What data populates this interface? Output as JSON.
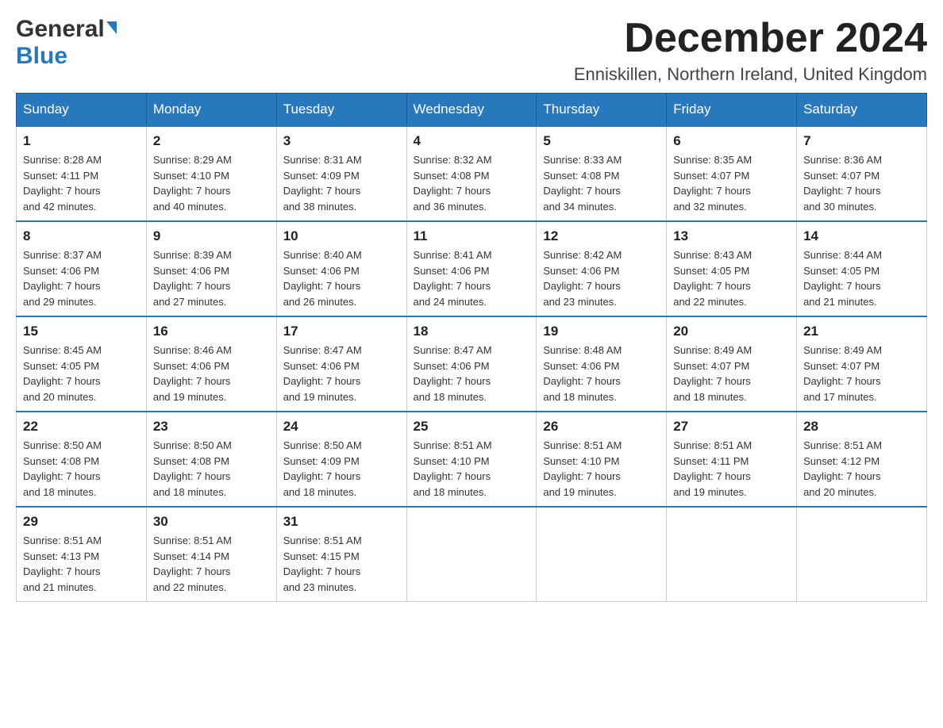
{
  "header": {
    "logo_general": "General",
    "logo_blue": "Blue",
    "month_title": "December 2024",
    "location": "Enniskillen, Northern Ireland, United Kingdom"
  },
  "days_of_week": [
    "Sunday",
    "Monday",
    "Tuesday",
    "Wednesday",
    "Thursday",
    "Friday",
    "Saturday"
  ],
  "weeks": [
    [
      {
        "day": "1",
        "sunrise": "8:28 AM",
        "sunset": "4:11 PM",
        "daylight": "7 hours and 42 minutes."
      },
      {
        "day": "2",
        "sunrise": "8:29 AM",
        "sunset": "4:10 PM",
        "daylight": "7 hours and 40 minutes."
      },
      {
        "day": "3",
        "sunrise": "8:31 AM",
        "sunset": "4:09 PM",
        "daylight": "7 hours and 38 minutes."
      },
      {
        "day": "4",
        "sunrise": "8:32 AM",
        "sunset": "4:08 PM",
        "daylight": "7 hours and 36 minutes."
      },
      {
        "day": "5",
        "sunrise": "8:33 AM",
        "sunset": "4:08 PM",
        "daylight": "7 hours and 34 minutes."
      },
      {
        "day": "6",
        "sunrise": "8:35 AM",
        "sunset": "4:07 PM",
        "daylight": "7 hours and 32 minutes."
      },
      {
        "day": "7",
        "sunrise": "8:36 AM",
        "sunset": "4:07 PM",
        "daylight": "7 hours and 30 minutes."
      }
    ],
    [
      {
        "day": "8",
        "sunrise": "8:37 AM",
        "sunset": "4:06 PM",
        "daylight": "7 hours and 29 minutes."
      },
      {
        "day": "9",
        "sunrise": "8:39 AM",
        "sunset": "4:06 PM",
        "daylight": "7 hours and 27 minutes."
      },
      {
        "day": "10",
        "sunrise": "8:40 AM",
        "sunset": "4:06 PM",
        "daylight": "7 hours and 26 minutes."
      },
      {
        "day": "11",
        "sunrise": "8:41 AM",
        "sunset": "4:06 PM",
        "daylight": "7 hours and 24 minutes."
      },
      {
        "day": "12",
        "sunrise": "8:42 AM",
        "sunset": "4:06 PM",
        "daylight": "7 hours and 23 minutes."
      },
      {
        "day": "13",
        "sunrise": "8:43 AM",
        "sunset": "4:05 PM",
        "daylight": "7 hours and 22 minutes."
      },
      {
        "day": "14",
        "sunrise": "8:44 AM",
        "sunset": "4:05 PM",
        "daylight": "7 hours and 21 minutes."
      }
    ],
    [
      {
        "day": "15",
        "sunrise": "8:45 AM",
        "sunset": "4:05 PM",
        "daylight": "7 hours and 20 minutes."
      },
      {
        "day": "16",
        "sunrise": "8:46 AM",
        "sunset": "4:06 PM",
        "daylight": "7 hours and 19 minutes."
      },
      {
        "day": "17",
        "sunrise": "8:47 AM",
        "sunset": "4:06 PM",
        "daylight": "7 hours and 19 minutes."
      },
      {
        "day": "18",
        "sunrise": "8:47 AM",
        "sunset": "4:06 PM",
        "daylight": "7 hours and 18 minutes."
      },
      {
        "day": "19",
        "sunrise": "8:48 AM",
        "sunset": "4:06 PM",
        "daylight": "7 hours and 18 minutes."
      },
      {
        "day": "20",
        "sunrise": "8:49 AM",
        "sunset": "4:07 PM",
        "daylight": "7 hours and 18 minutes."
      },
      {
        "day": "21",
        "sunrise": "8:49 AM",
        "sunset": "4:07 PM",
        "daylight": "7 hours and 17 minutes."
      }
    ],
    [
      {
        "day": "22",
        "sunrise": "8:50 AM",
        "sunset": "4:08 PM",
        "daylight": "7 hours and 18 minutes."
      },
      {
        "day": "23",
        "sunrise": "8:50 AM",
        "sunset": "4:08 PM",
        "daylight": "7 hours and 18 minutes."
      },
      {
        "day": "24",
        "sunrise": "8:50 AM",
        "sunset": "4:09 PM",
        "daylight": "7 hours and 18 minutes."
      },
      {
        "day": "25",
        "sunrise": "8:51 AM",
        "sunset": "4:10 PM",
        "daylight": "7 hours and 18 minutes."
      },
      {
        "day": "26",
        "sunrise": "8:51 AM",
        "sunset": "4:10 PM",
        "daylight": "7 hours and 19 minutes."
      },
      {
        "day": "27",
        "sunrise": "8:51 AM",
        "sunset": "4:11 PM",
        "daylight": "7 hours and 19 minutes."
      },
      {
        "day": "28",
        "sunrise": "8:51 AM",
        "sunset": "4:12 PM",
        "daylight": "7 hours and 20 minutes."
      }
    ],
    [
      {
        "day": "29",
        "sunrise": "8:51 AM",
        "sunset": "4:13 PM",
        "daylight": "7 hours and 21 minutes."
      },
      {
        "day": "30",
        "sunrise": "8:51 AM",
        "sunset": "4:14 PM",
        "daylight": "7 hours and 22 minutes."
      },
      {
        "day": "31",
        "sunrise": "8:51 AM",
        "sunset": "4:15 PM",
        "daylight": "7 hours and 23 minutes."
      },
      null,
      null,
      null,
      null
    ]
  ],
  "labels": {
    "sunrise": "Sunrise:",
    "sunset": "Sunset:",
    "daylight": "Daylight:"
  }
}
